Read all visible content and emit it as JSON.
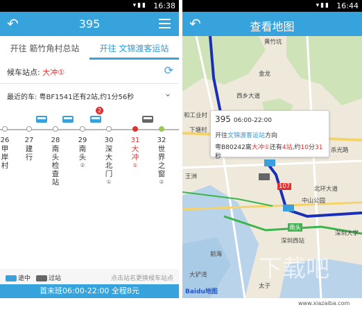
{
  "left_screen": {
    "status_time": "16:38",
    "title": "395",
    "tabs": [
      "开往 簕竹角村总站",
      "开往 文锦渡客运站"
    ],
    "waiting_stop_label": "候车站点:",
    "waiting_stop_value": "大冲①",
    "nearest_bus_text": "最近的车: 粤BF1541还有2站,约1分56秒",
    "badge_count": "2",
    "stops": [
      {
        "num": "26",
        "name": "甲岸村",
        "seq": ""
      },
      {
        "num": "27",
        "name": "建行",
        "seq": ""
      },
      {
        "num": "28",
        "name": "南头检查站",
        "seq": ""
      },
      {
        "num": "29",
        "name": "南头",
        "seq": "②"
      },
      {
        "num": "30",
        "name": "深大北门",
        "seq": "①"
      },
      {
        "num": "31",
        "name": "大冲",
        "seq": "①"
      },
      {
        "num": "32",
        "name": "世界之窗",
        "seq": "②"
      }
    ],
    "legend_moving": "途中",
    "legend_arrived": "过站",
    "hint": "点击站名更换候车站点",
    "footer": "首末班06:00-22:00 全程8元"
  },
  "right_screen": {
    "status_time": "16:44",
    "title": "查看地图",
    "popup_route": "395",
    "popup_time": "06:00-22:00",
    "popup_dir_prefix": "开往",
    "popup_dir_station": "文锦渡客运站",
    "popup_dir_suffix": "方向",
    "popup_bus_prefix": "粤B80242离",
    "popup_bus_stop": "大冲①",
    "popup_bus_mid": "还有",
    "popup_bus_count": "4站",
    "popup_bus_tail": ",约",
    "popup_bus_min": "10",
    "popup_bus_min_unit": "分",
    "popup_bus_sec": "31",
    "popup_bus_sec_unit": "秒",
    "map_labels": [
      "黄竹坑",
      "金龙",
      "西乡大道",
      "和工业村",
      "下塘村",
      "王洲",
      "北环大道",
      "107",
      "中山公园",
      "南头",
      "深圳西站",
      "前海",
      "深圳大学",
      "大铲湾",
      "太子",
      "杀光路"
    ],
    "baidu": "Baidu地图",
    "watermark": "下载吧",
    "watermark_url": "www.xiazaiba.com"
  },
  "colors": {
    "primary": "#36a3dc",
    "accent_red": "#e03030",
    "route_blue": "#1a2fb8"
  }
}
